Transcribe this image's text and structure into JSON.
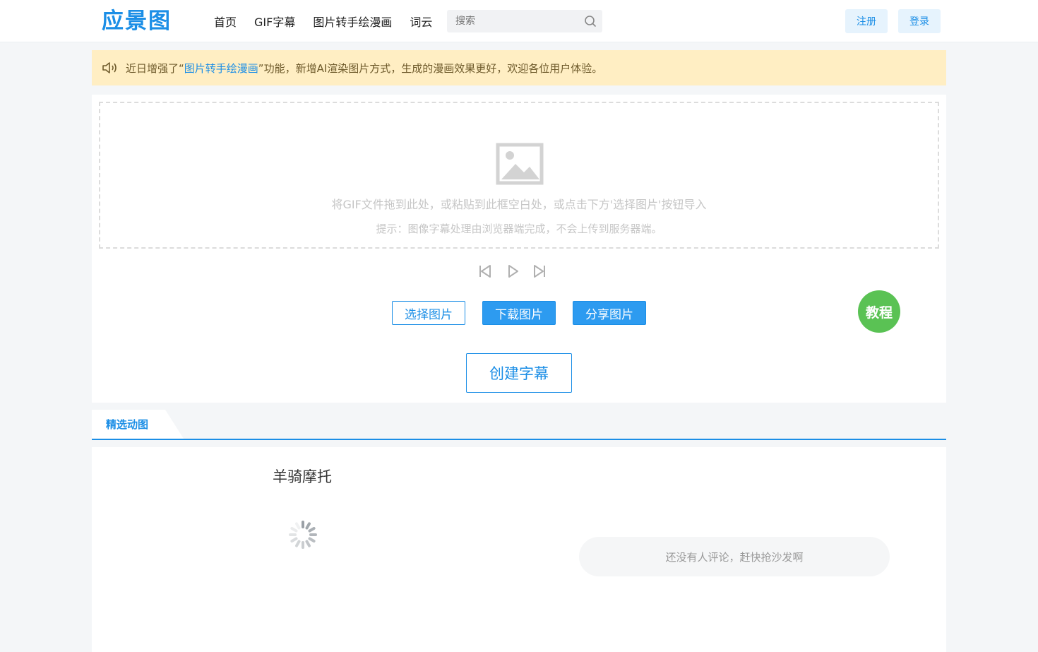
{
  "header": {
    "logo": "应景图",
    "nav": [
      "首页",
      "GIF字幕",
      "图片转手绘漫画",
      "词云"
    ],
    "search": {
      "placeholder": "搜索",
      "icon": "search-icon"
    },
    "register_label": "注册",
    "login_label": "登录"
  },
  "notice": {
    "icon": "speaker-icon",
    "prefix": "近日增强了“",
    "link": "图片转手绘漫画",
    "suffix": "”功能，新增AI渲染图片方式，生成的漫画效果更好，欢迎各位用户体验。"
  },
  "editor": {
    "dropzone_icon": "image-placeholder-icon",
    "dropzone_text": "将GIF文件拖到此处，或粘贴到此框空白处，或点击下方'选择图片'按钮导入",
    "dropzone_hint": "提示：图像字幕处理由浏览器端完成，不会上传到服务器端。",
    "player_icons": [
      "skip-back-icon",
      "play-icon",
      "skip-forward-icon"
    ],
    "select_label": "选择图片",
    "download_label": "下载图片",
    "share_label": "分享图片",
    "tutorial_label": "教程",
    "create_label": "创建字幕"
  },
  "featured": {
    "tab_label": "精选动图",
    "title": "羊骑摩托",
    "loading_icon": "spinner-icon",
    "comment_placeholder": "还没有人评论，赶快抢沙发啊"
  },
  "colors": {
    "accent": "#1b8ee6",
    "notice_bg": "#ffeec3",
    "tutorial_green": "#5ac254"
  }
}
